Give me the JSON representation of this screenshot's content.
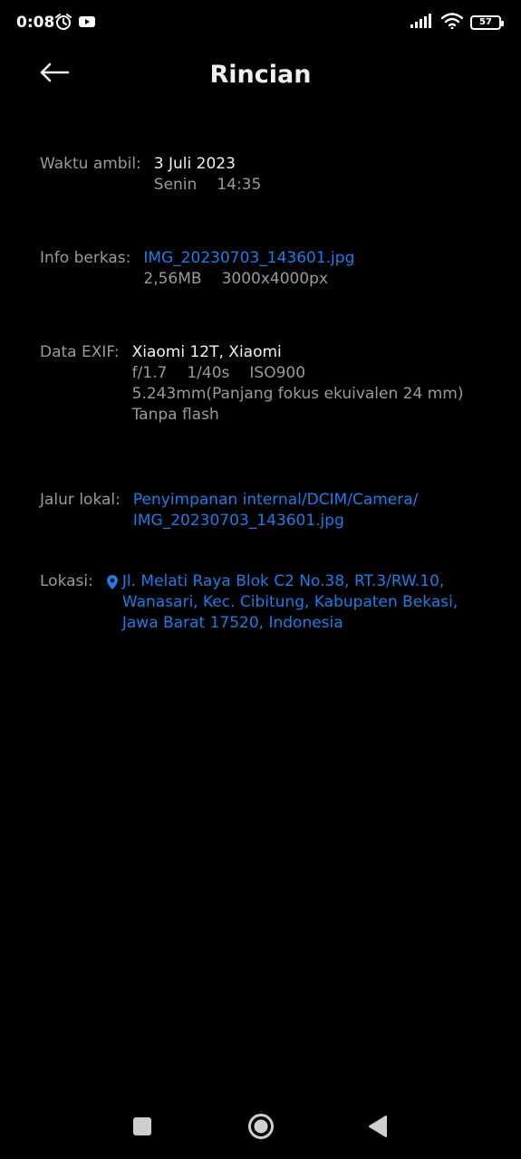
{
  "status_bar": {
    "time": "0:08",
    "battery": "57",
    "left_icons": [
      "alarm-icon",
      "youtube-icon"
    ],
    "right_icons": [
      "signal-icon",
      "wifi-icon",
      "battery-icon"
    ]
  },
  "header": {
    "title": "Rincian",
    "back_icon": "arrow-left-icon"
  },
  "details": {
    "time": {
      "label": "Waktu ambil:",
      "date": "3 Juli 2023",
      "day": "Senin",
      "clock": "14:35"
    },
    "file": {
      "label": "Info berkas:",
      "name": "IMG_20230703_143601.jpg",
      "size": "2,56MB",
      "resolution": "3000x4000px"
    },
    "exif": {
      "label": "Data EXIF:",
      "device": "Xiaomi 12T, Xiaomi",
      "aperture": "f/1.7",
      "shutter": "1/40s",
      "iso": "ISO900",
      "focal": "5.243mm(Panjang fokus ekuivalen 24 mm)",
      "flash": "Tanpa flash"
    },
    "path": {
      "label": "Jalur lokal:",
      "line1": "Penyimpanan internal/DCIM/Camera/",
      "line2": "IMG_20230703_143601.jpg"
    },
    "location": {
      "label": "Lokasi:",
      "line1": "Jl. Melati Raya Blok C2 No.38, RT.3/RW.10,",
      "line2": "Wanasari, Kec. Cibitung, Kabupaten Bekasi,",
      "line3": "Jawa Barat 17520, Indonesia",
      "icon": "location-pin-icon"
    }
  },
  "nav_bar": {
    "icons": [
      "recents-square-icon",
      "home-circle-icon",
      "back-triangle-icon"
    ]
  },
  "colors": {
    "background": "#000000",
    "link": "#1a7ee8",
    "label": "#9a9a9a",
    "text": "#f2f2f2"
  }
}
